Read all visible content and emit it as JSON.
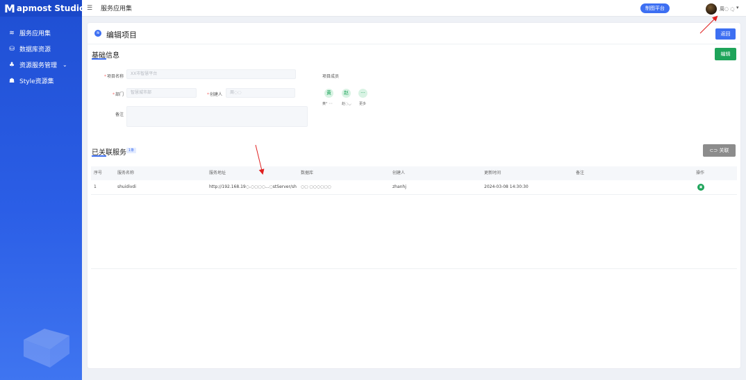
{
  "app": {
    "logo_mark": "M",
    "name": "apmost Studio"
  },
  "sidebar": {
    "items": [
      {
        "label": "服务应用集",
        "icon": "layers-icon"
      },
      {
        "label": "数据库资源",
        "icon": "database-icon"
      },
      {
        "label": "资源服务管理",
        "icon": "cluster-icon"
      },
      {
        "label": "Style资源集",
        "icon": "style-icon"
      }
    ]
  },
  "topbar": {
    "breadcrumb": "服务应用集",
    "platform_button": "制图平台",
    "username": "周◌ ◌̣",
    "user_chevron": "▾"
  },
  "page": {
    "title": "编辑项目",
    "back_button": "返回"
  },
  "basic_info": {
    "title": "基础信息",
    "edit_button": "编辑",
    "fields": {
      "project_name_label": "项目名称",
      "project_name_placeholder": "XX市智慧平台",
      "dept_label": "部门",
      "dept_placeholder": "智慧城市部",
      "creator_label": "创建人",
      "creator_value": "周◌◌",
      "remark_label": "备注",
      "members_label": "项目成员"
    },
    "members": [
      {
        "avatar": "黄",
        "name": "黄° ◦◦"
      },
      {
        "avatar": "赵",
        "name": "赵◌◡"
      },
      {
        "avatar": "···",
        "name": "更多"
      }
    ]
  },
  "linked_services": {
    "title": "已关联服务",
    "count_badge": "1条",
    "link_button": "关联",
    "columns": [
      "序号",
      "服务名称",
      "服务地址",
      "数据库",
      "创建人",
      "更新时间",
      "备注",
      "操作"
    ],
    "rows": [
      {
        "index": "1",
        "name": "shuidivdi",
        "address": "http://192.168.19◌.◌◌◌◌...◌stServer/shuidi...",
        "database": "◌◌ ◌◌◌◌◌◌",
        "creator": "zhanhj",
        "updated": "2024-03-08 14:30:30",
        "remark": ""
      }
    ]
  },
  "colors": {
    "primary": "#3d6ff2",
    "success": "#1ea45a",
    "sidebar_top": "#1f4fd3",
    "annotation": "#e02020"
  }
}
